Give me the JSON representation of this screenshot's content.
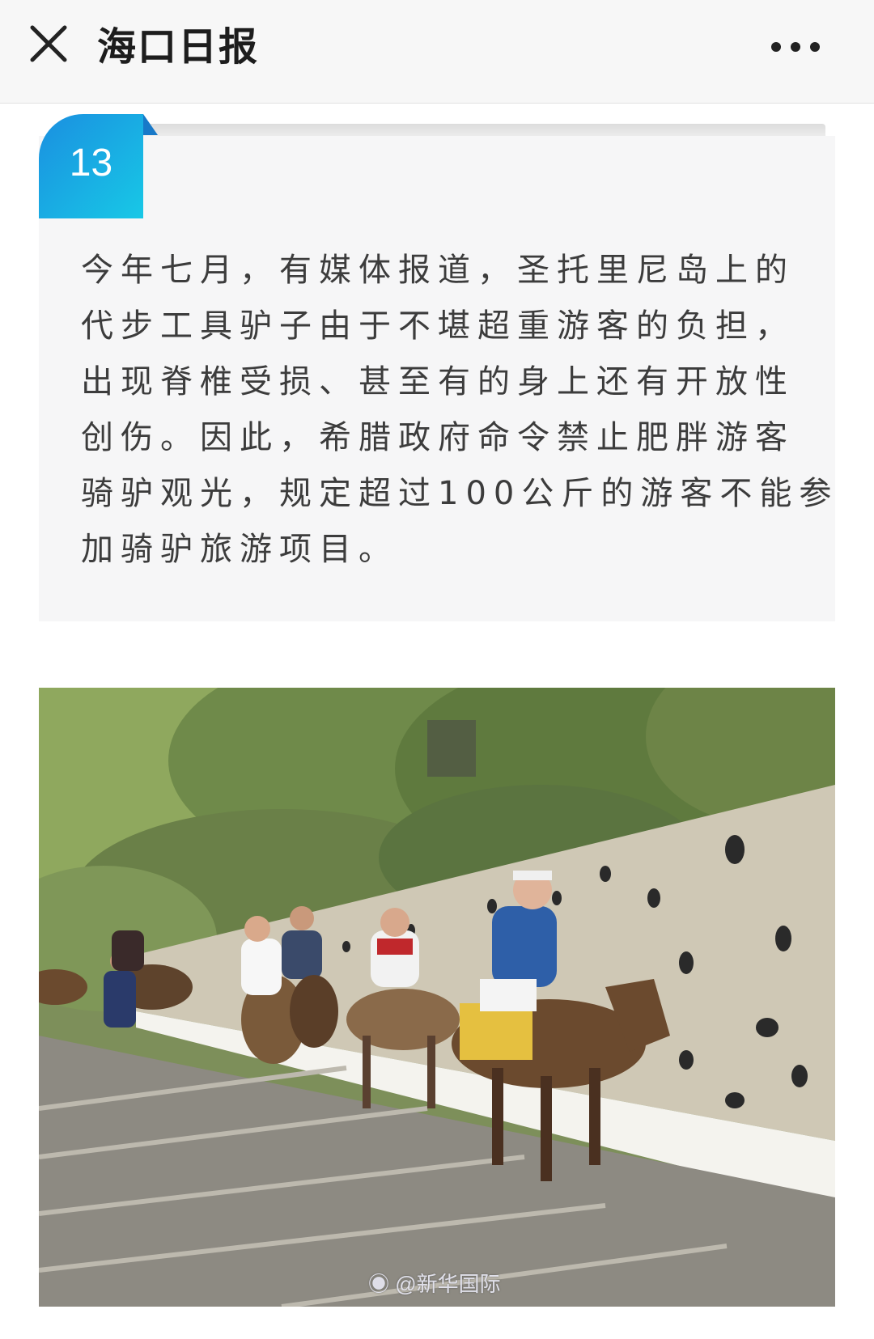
{
  "header": {
    "title": "海口日报",
    "close_icon": "close-icon",
    "more_icon": "more-icon"
  },
  "article": {
    "item_number": "13",
    "paragraph_lines": [
      "今年七月，有媒体报道，圣托里尼岛上的",
      "代步工具驴子由于不堪超重游客的负担，",
      "出现脊椎受损、甚至有的身上还有开放性",
      "创伤。因此，希腊政府命令禁止肥胖游客",
      "骑驴观光，规定超过100公斤的游客不能参",
      "加骑驴旅游项目。"
    ]
  },
  "photo": {
    "description_icon": "photo-donkeys-image",
    "watermark": "@新华国际",
    "weibo_icon": "weibo-icon"
  },
  "colors": {
    "badge_start": "#1a8fe0",
    "badge_end": "#18c8e6",
    "card_bg": "#f6f6f7",
    "text": "#3c3c3c"
  }
}
